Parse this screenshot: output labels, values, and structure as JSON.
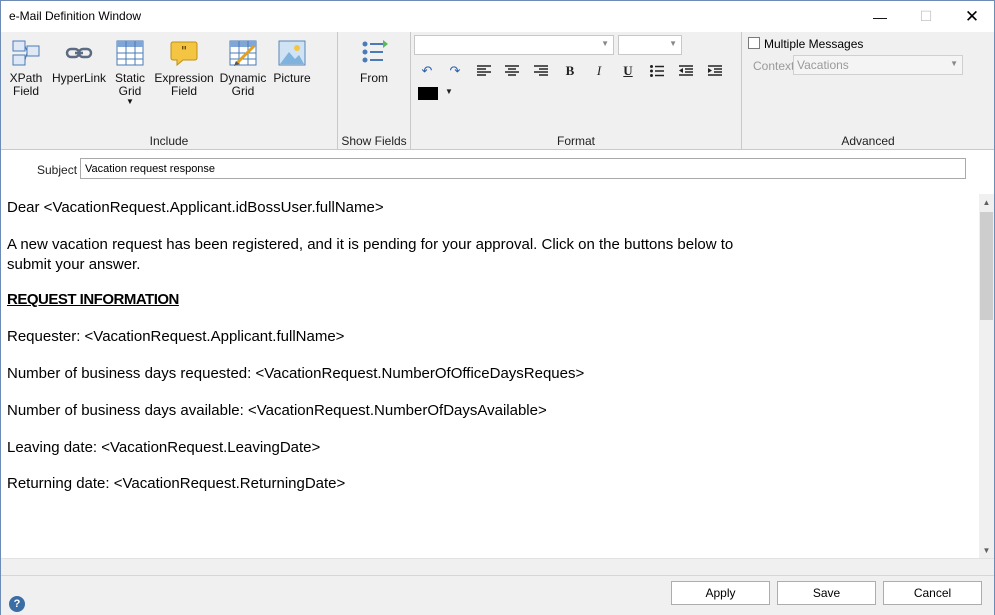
{
  "window": {
    "title": "e-Mail Definition Window",
    "minimize": "—",
    "maximize": "☐",
    "close": "✕"
  },
  "ribbon": {
    "include": {
      "label": "Include",
      "buttons": [
        {
          "label": "XPath\nField",
          "icon": "xpath-field-icon"
        },
        {
          "label": "HyperLink",
          "icon": "hyperlink-icon"
        },
        {
          "label": "Static\nGrid",
          "icon": "static-grid-icon"
        },
        {
          "label": "Expression\nField",
          "icon": "expression-field-icon"
        },
        {
          "label": "Dynamic\nGrid",
          "icon": "dynamic-grid-icon"
        },
        {
          "label": "Picture",
          "icon": "picture-icon"
        }
      ]
    },
    "show_fields": {
      "label": "Show Fields",
      "from_label": "From"
    },
    "format": {
      "label": "Format",
      "font_value": "",
      "size_value": ""
    },
    "advanced": {
      "label": "Advanced",
      "multiple_messages_label": "Multiple Messages",
      "context_label": "Context",
      "context_value": "Vacations"
    }
  },
  "subject": {
    "label": "Subject",
    "value": "Vacation request response"
  },
  "body": {
    "greeting": "Dear <VacationRequest.Applicant.idBossUser.fullName>",
    "intro_line1": "A new vacation request has been registered, and it is pending for your approval. Click on the buttons below to",
    "intro_line2": "submit your answer.",
    "heading": "REQUEST INFORMATION",
    "requester": "Requester: <VacationRequest.Applicant.fullName>",
    "days_requested": "Number of business days requested: <VacationRequest.NumberOfOfficeDaysReques>",
    "days_available": "Number of business days available: <VacationRequest.NumberOfDaysAvailable>",
    "leaving_date": "Leaving date: <VacationRequest.LeavingDate>",
    "returning_date": "Returning date: <VacationRequest.ReturningDate>"
  },
  "footer": {
    "apply": "Apply",
    "save": "Save",
    "cancel": "Cancel",
    "help": "?"
  },
  "colors": {
    "ribbon_bg": "#f0f0f0",
    "accent_blue": "#3b6ea5",
    "icon_yellow": "#f4c542"
  }
}
